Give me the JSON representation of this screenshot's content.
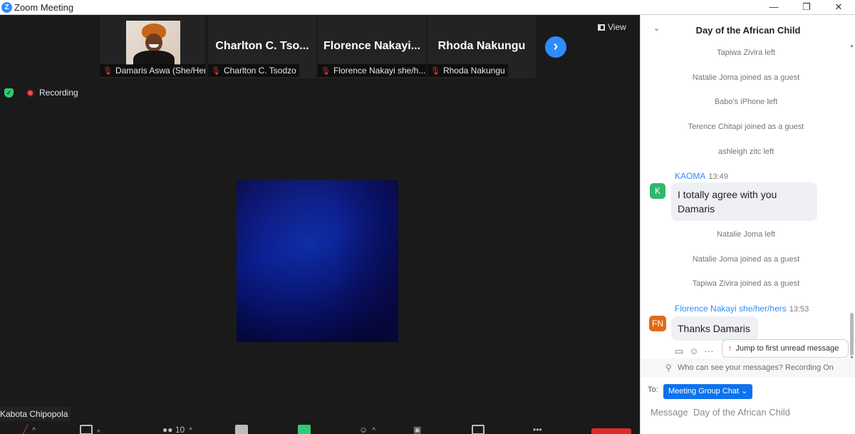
{
  "window": {
    "title": "Zoom Meeting",
    "controls": [
      "—",
      "❐",
      "✕"
    ]
  },
  "gallery": {
    "tiles": [
      {
        "name": "",
        "label": "Damaris Aswa (She/Her)"
      },
      {
        "name": "Charlton C. Tso...",
        "label": "Charlton C. Tsodzo"
      },
      {
        "name": "Florence Nakayi...",
        "label": "Florence Nakayi she/h..."
      },
      {
        "name": "Rhoda Nakungu",
        "label": "Rhoda Nakungu"
      }
    ],
    "next_icon": "›",
    "view_label": "View"
  },
  "status": {
    "recording_label": "Recording"
  },
  "active_speaker": {
    "name_label": "Kabota Chipopola"
  },
  "toolbar": {
    "participants_count": "10",
    "caret": "^"
  },
  "chat": {
    "title": "Day of the African Child",
    "collapse_icon": "⌄",
    "system_messages": [
      "Tapiwa Zivira left",
      "Natalie Joma joined as a guest",
      "Babo's iPhone left",
      "Terence Chitapi joined as a guest",
      "ashleigh zitc left",
      "Natalie Joma left",
      "Natalie Joma joined as a guest",
      "Tapiwa Zivira joined as a guest"
    ],
    "messages": [
      {
        "sender": "KAOMA",
        "time": "13:49",
        "initials": "K",
        "text_line1": "I totally agree with you",
        "text_line2": "Damaris"
      },
      {
        "sender": "Florence Nakayi she/her/hers",
        "time": "13:53",
        "initials": "FN",
        "text": "Thanks Damaris"
      }
    ],
    "jump_label": "Jump to first unread message",
    "privacy_text": "Who can see your messages? Recording On",
    "to_label": "To:",
    "recipient": "Meeting Group Chat ⌄",
    "input_placeholder": "Message  Day of the African Child"
  },
  "colors": {
    "accent": "#2d8cff",
    "recording": "#ff4a4a",
    "mute": "#e03a3a",
    "panel": "#1a1a1a"
  },
  "icons": [
    "zoom-logo-icon",
    "shield-icon",
    "record-icon",
    "mic-muted-icon",
    "grid-view-icon",
    "chevron-right-icon",
    "emoji-icon",
    "reply-icon",
    "more-icon",
    "up-arrow-icon",
    "person-icon"
  ]
}
